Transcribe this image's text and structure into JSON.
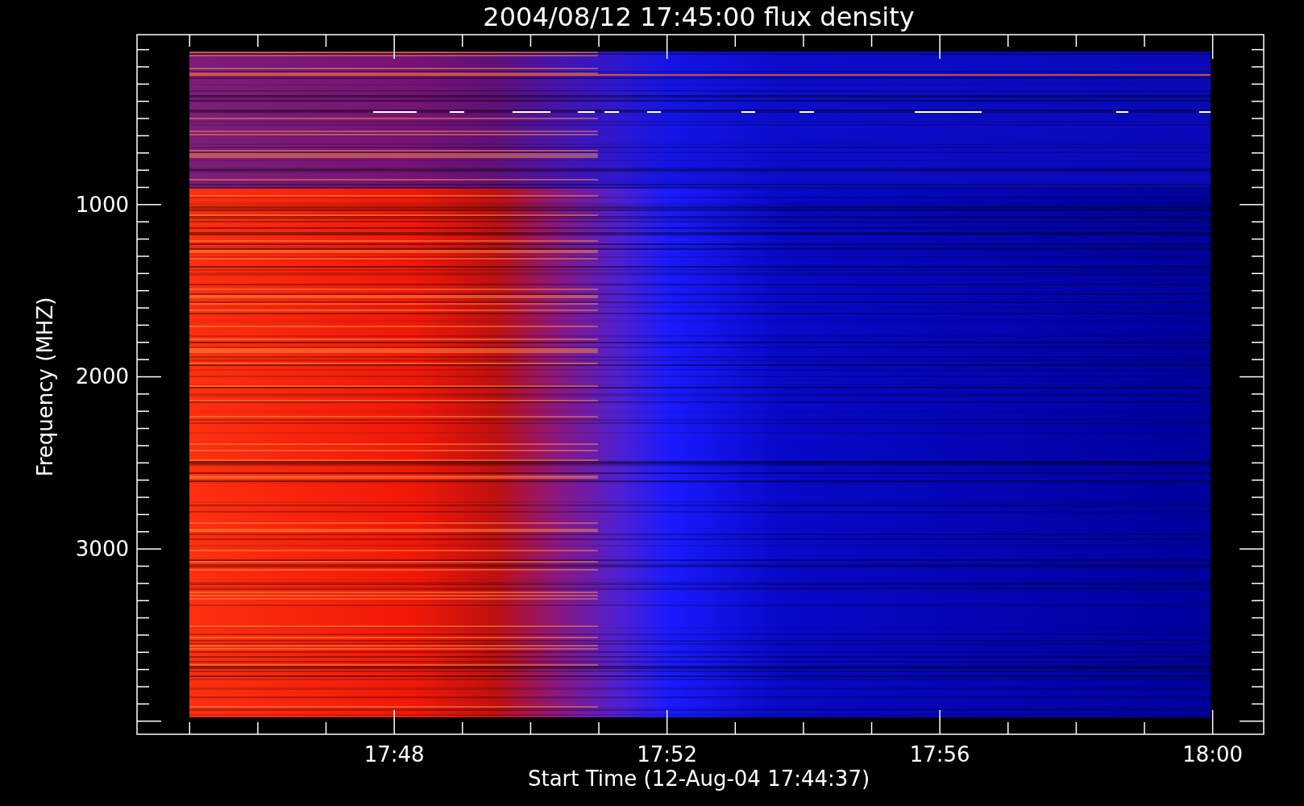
{
  "title": "2004/08/12 17:45:00 flux density",
  "xlabel": "Start Time (12-Aug-04 17:44:37)",
  "ylabel": "Frequency (MHZ)",
  "xtick_labels": [
    "17:48",
    "17:52",
    "17:56",
    "18:00"
  ],
  "ytick_labels": [
    "1000",
    "2000",
    "3000"
  ]
}
